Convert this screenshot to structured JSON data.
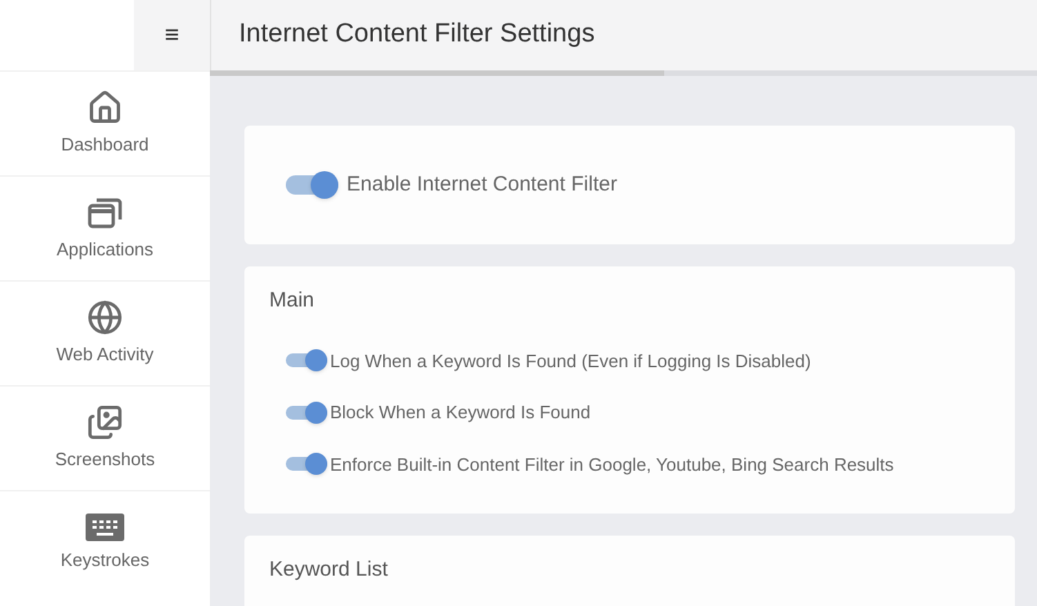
{
  "menu_button": {
    "label": "≡"
  },
  "header": {
    "title": "Internet Content Filter Settings"
  },
  "loading_bar": {
    "level": 0.55
  },
  "sidebar": {
    "items": [
      {
        "label": "Dashboard",
        "kind": "home"
      },
      {
        "label": "Applications",
        "kind": "windows"
      },
      {
        "label": "Web Activity",
        "kind": "globe"
      },
      {
        "label": "Screenshots",
        "kind": "images"
      },
      {
        "label": "Keystrokes",
        "kind": "keyboard"
      }
    ]
  },
  "master_toggle": {
    "label": "Enable Internet Content Filter",
    "on": true
  },
  "sections": [
    {
      "title": "Main",
      "toggles": [
        {
          "label": "Log When a Keyword Is Found (Even if Logging Is Disabled)",
          "on": true
        },
        {
          "label": "Block When a Keyword Is Found",
          "on": true
        },
        {
          "label": "Enforce Built-in Content Filter in Google, Youtube, Bing Search Results",
          "on": true
        }
      ]
    },
    {
      "title": "Keyword List"
    }
  ]
}
